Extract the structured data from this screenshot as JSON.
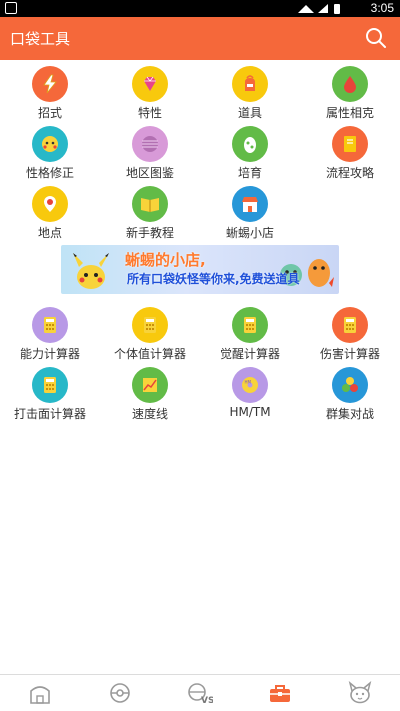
{
  "status_bar": {
    "time": "3:05"
  },
  "app_bar": {
    "title": "口袋工具",
    "search_icon": "search-icon"
  },
  "tools": [
    {
      "label": "招式",
      "icon": "lightning-icon",
      "color": "#f5683a"
    },
    {
      "label": "特性",
      "icon": "gem-icon",
      "color": "#f8c90d"
    },
    {
      "label": "道具",
      "icon": "bag-icon",
      "color": "#f8c90d"
    },
    {
      "label": "属性相克",
      "icon": "drop-icon",
      "color": "#62bb47"
    },
    {
      "label": "性格修正",
      "icon": "face-icon",
      "color": "#27b8c8"
    },
    {
      "label": "地区图鉴",
      "icon": "ball-icon",
      "color": "#d89ad8"
    },
    {
      "label": "培育",
      "icon": "egg-icon",
      "color": "#62bb47"
    },
    {
      "label": "流程攻略",
      "icon": "book-icon",
      "color": "#f5683a"
    },
    {
      "label": "地点",
      "icon": "pin-icon",
      "color": "#f8c90d"
    },
    {
      "label": "新手教程",
      "icon": "open-book-icon",
      "color": "#62bb47"
    },
    {
      "label": "蜥蜴小店",
      "icon": "shop-icon",
      "color": "#2797d8"
    }
  ],
  "banner": {
    "line1": "蜥蜴的小店,",
    "line2": "所有口袋妖怪等你来,免费送道具"
  },
  "calculators": [
    {
      "label": "能力计算器",
      "icon": "calculator-icon",
      "color": "#b899e6"
    },
    {
      "label": "个体值计算器",
      "icon": "calculator-icon",
      "color": "#f8c90d"
    },
    {
      "label": "觉醒计算器",
      "icon": "calculator-icon",
      "color": "#62bb47"
    },
    {
      "label": "伤害计算器",
      "icon": "calculator-icon",
      "color": "#f5683a"
    },
    {
      "label": "打击面计算器",
      "icon": "calculator-icon",
      "color": "#27b8c8"
    },
    {
      "label": "速度线",
      "icon": "chart-icon",
      "color": "#62bb47"
    },
    {
      "label": "HM/TM",
      "icon": "disc-icon",
      "color": "#b899e6"
    },
    {
      "label": "群集对战",
      "icon": "balls-icon",
      "color": "#2797d8"
    }
  ],
  "bottom_nav": [
    {
      "name": "home-tab",
      "icon": "house-icon"
    },
    {
      "name": "pokedex-tab",
      "icon": "pokeball-icon"
    },
    {
      "name": "battle-tab",
      "icon": "vs-icon"
    },
    {
      "name": "tools-tab",
      "icon": "toolbox-icon",
      "active_color": "#f5683a"
    },
    {
      "name": "profile-tab",
      "icon": "pikachu-icon"
    }
  ]
}
